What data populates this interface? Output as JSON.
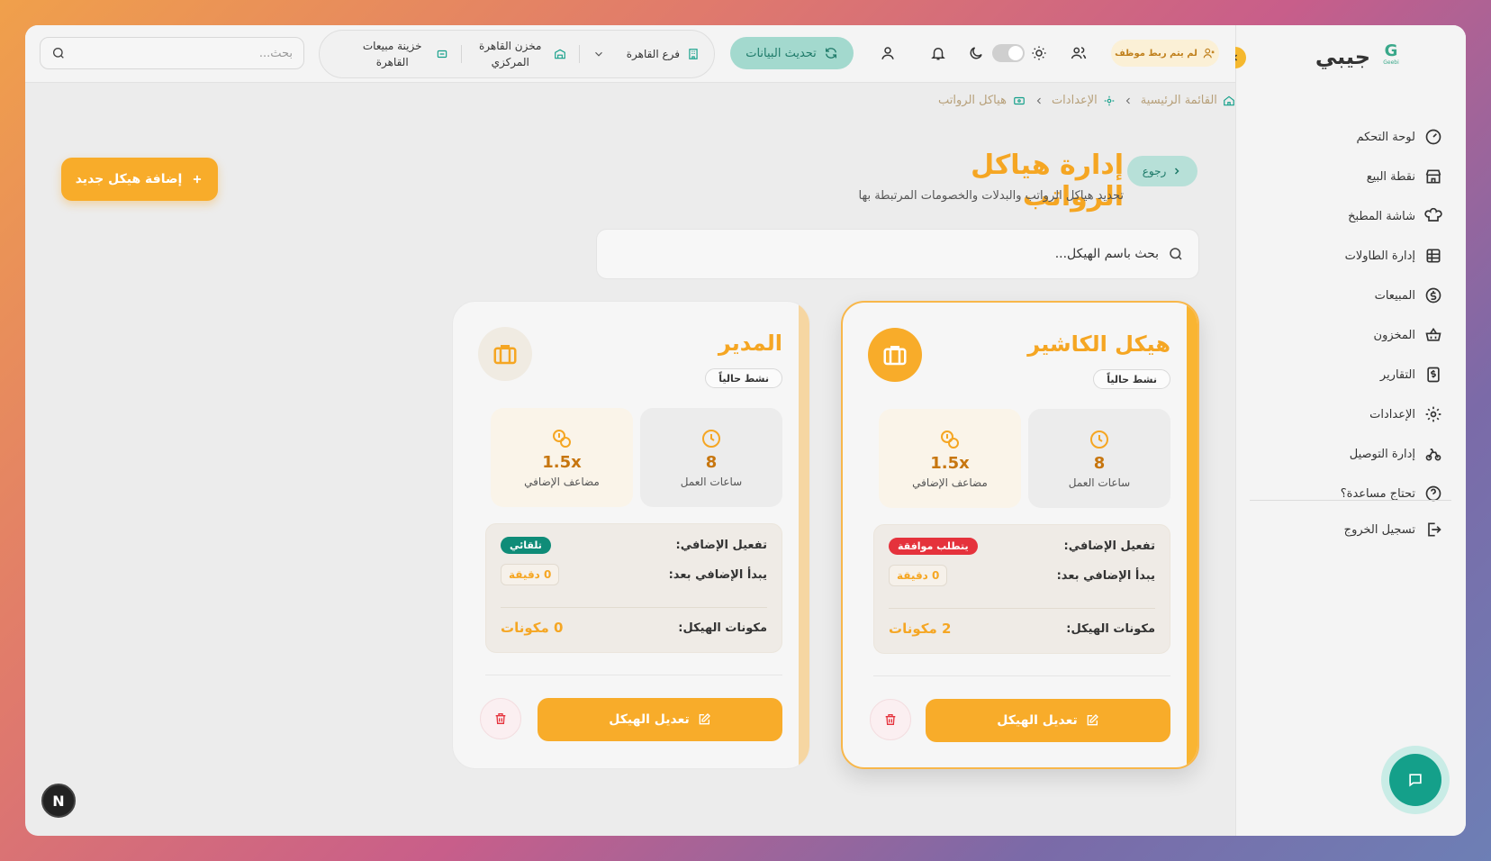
{
  "app": {
    "brand_name": "جيبي",
    "logo_letter": "G",
    "logo_text": "Geebi"
  },
  "sidebar": {
    "items": [
      {
        "label": "لوحة التحكم",
        "icon": "gauge-icon"
      },
      {
        "label": "نقطة البيع",
        "icon": "store-icon"
      },
      {
        "label": "شاشة المطبخ",
        "icon": "chef-hat-icon"
      },
      {
        "label": "إدارة الطاولات",
        "icon": "table-icon"
      },
      {
        "label": "المبيعات",
        "icon": "dollar-circle-icon"
      },
      {
        "label": "المخزون",
        "icon": "basket-icon"
      },
      {
        "label": "التقارير",
        "icon": "report-dollar-icon"
      },
      {
        "label": "الإعدادات",
        "icon": "gear-icon"
      },
      {
        "label": "إدارة التوصيل",
        "icon": "bike-icon"
      },
      {
        "label": "تحتاج مساعدة؟",
        "icon": "help-circle-icon"
      }
    ],
    "logout_label": "تسجيل الخروج"
  },
  "topbar": {
    "search_placeholder": "بحث...",
    "treasury": "خزينة مبيعات القاهرة",
    "warehouse": "مخزن القاهرة المركزي",
    "branch": "فرع القاهرة",
    "refresh_label": "تحديث البيانات",
    "staff_badge": "لم يتم ربط موظف"
  },
  "breadcrumb": {
    "home": "القائمة الرئيسية",
    "settings": "الإعدادات",
    "current": "هياكل الرواتب"
  },
  "page": {
    "back_label": "رجوع",
    "title": "إدارة هياكل الرواتب",
    "subtitle": "تحديد هياكل الرواتب والبدلات والخصومات المرتبطة بها",
    "add_label": "إضافة هيكل جديد",
    "search_placeholder": "بحث باسم الهيكل..."
  },
  "labels": {
    "work_hours": "ساعات العمل",
    "ot_multiplier": "مضاعف الإضافي",
    "ot_activation": "تفعيل الإضافي:",
    "ot_starts_after": "يبدأ الإضافي بعد:",
    "components": "مكونات الهيكل:",
    "edit": "تعديل الهيكل"
  },
  "cards": [
    {
      "name": "هيكل الكاشير",
      "status": "نشط حالياً",
      "hours": "8",
      "multiplier": "1.5x",
      "ot_mode": "يتطلب موافقة",
      "ot_after": "0 دقيقة",
      "components": "2 مكونات"
    },
    {
      "name": "المدير",
      "status": "نشط حالياً",
      "hours": "8",
      "multiplier": "1.5x",
      "ot_mode": "تلقائي",
      "ot_after": "0 دقيقة",
      "components": "0 مكونات"
    }
  ],
  "misc": {
    "n_badge": "N"
  },
  "colors": {
    "accent": "#f5a623",
    "teal": "#14a08a",
    "danger": "#e5323c"
  }
}
